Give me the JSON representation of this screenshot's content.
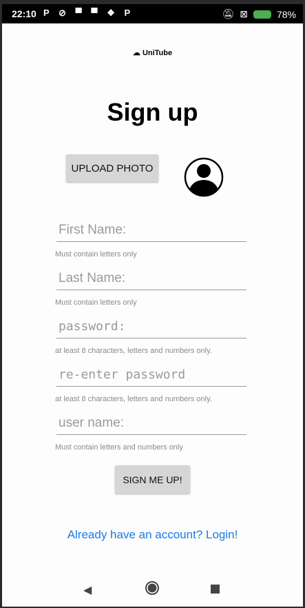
{
  "status": {
    "time": "22:10",
    "notification_icons": "P ⊘ ▀ ▀ ❖ P",
    "battery": "78%"
  },
  "app": {
    "logo": "UniTube",
    "title": "Sign up"
  },
  "upload_button": "UPLOAD PHOTO",
  "fields": [
    {
      "placeholder": "First Name:",
      "hint": "Must contain letters only"
    },
    {
      "placeholder": "Last Name:",
      "hint": "Must contain letters only"
    },
    {
      "placeholder": "password:",
      "hint": "at least 8 characters, letters and numbers only."
    },
    {
      "placeholder": "re-enter password",
      "hint": "at least 8 characters, letters and numbers only."
    },
    {
      "placeholder": "user name:",
      "hint": "Must contain letters and numbers only"
    }
  ],
  "submit_button": "SIGN ME UP!",
  "login_link": "Already have an account? Login!"
}
